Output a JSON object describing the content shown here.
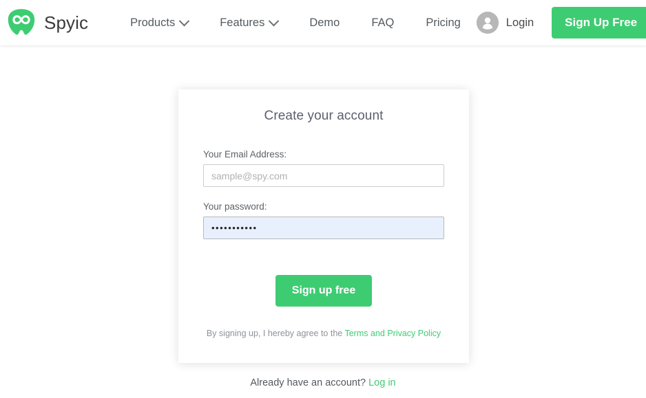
{
  "header": {
    "brand": {
      "name": "Spyic",
      "logo_icon": "infinity-logo-icon",
      "logo_color": "#3ecc72"
    },
    "nav": [
      {
        "label": "Products",
        "has_dropdown": true,
        "icon": "chevron-down-icon"
      },
      {
        "label": "Features",
        "has_dropdown": true,
        "icon": "chevron-down-icon"
      },
      {
        "label": "Demo",
        "has_dropdown": false
      },
      {
        "label": "FAQ",
        "has_dropdown": false
      },
      {
        "label": "Pricing",
        "has_dropdown": false
      }
    ],
    "login": {
      "label": "Login",
      "icon": "user-avatar-icon"
    },
    "signup_button": {
      "label": "Sign Up Free",
      "color": "#3ecc72"
    }
  },
  "signup_card": {
    "title": "Create your account",
    "email_field": {
      "label": "Your Email Address:",
      "placeholder": "sample@spy.com",
      "value": ""
    },
    "password_field": {
      "label": "Your password:",
      "placeholder": "",
      "value": "•••••••••••"
    },
    "submit_button": {
      "label": "Sign up free",
      "color": "#3ecc72"
    },
    "terms": {
      "text": "By signing up, I hereby agree to the ",
      "link_label": "Terms and Privacy Policy"
    }
  },
  "footer": {
    "already_text": "Already have an account? ",
    "login_link": "Log in"
  }
}
